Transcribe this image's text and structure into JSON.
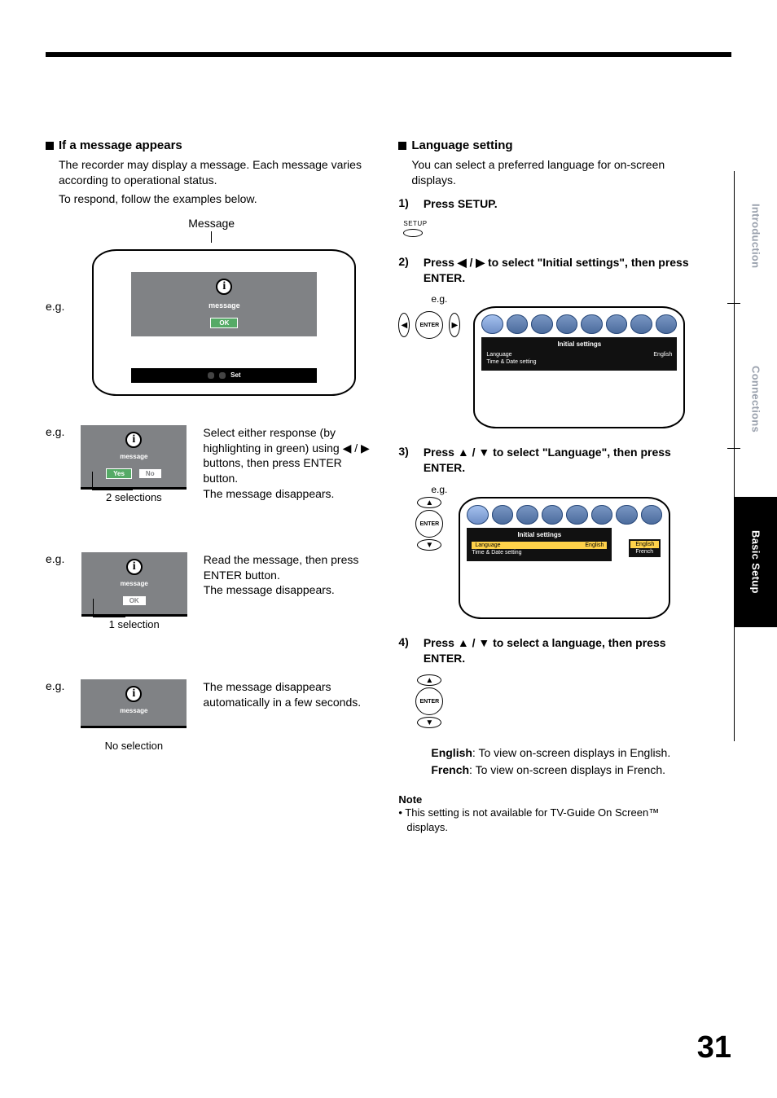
{
  "page_number": "31",
  "side_tabs": {
    "intro": "Introduction",
    "conn": "Connections",
    "basic": "Basic Setup"
  },
  "left": {
    "heading": "If a message appears",
    "intro_line1": "The recorder may display a message. Each message varies according to operational status.",
    "intro_line2": "To respond, follow the examples below.",
    "message_label": "Message",
    "eg": "e.g.",
    "tv_msg": "message",
    "ok": "OK",
    "set": "Set",
    "yes": "Yes",
    "no": "No",
    "cap2": "2 selections",
    "desc2_a": "Select either response (by highlighting in green) using",
    "desc2_b": "buttons, then press ENTER button.",
    "desc2_c": "The message disappears.",
    "cap1": "1 selection",
    "desc1_a": "Read the message, then press ENTER button.",
    "desc1_b": "The message disappears.",
    "cap0": "No selection",
    "desc0": "The message disappears automatically in a few seconds."
  },
  "right": {
    "heading": "Language setting",
    "intro": "You can select a preferred language for on-screen displays.",
    "setup_label": "SETUP",
    "enter_label": "ENTER",
    "eg": "e.g.",
    "step1": {
      "num": "1)",
      "text": "Press SETUP."
    },
    "step2": {
      "num": "2)",
      "pre": "Press ",
      "arrows": "◀ / ▶",
      "post": " to select \"Initial settings\", then press ENTER."
    },
    "step3": {
      "num": "3)",
      "pre": "Press ",
      "arrows": "▲ / ▼",
      "post": " to select \"Language\", then press ENTER."
    },
    "step4": {
      "num": "4)",
      "pre": "Press ",
      "arrows": "▲ / ▼",
      "post": " to select a language, then press ENTER."
    },
    "osd": {
      "title": "Initial settings",
      "row1_l": "Language",
      "row1_r": "English",
      "row2_l": "Time & Date setting",
      "opt_en": "English",
      "opt_fr": "French"
    },
    "lang_en_label": "English",
    "lang_en_desc": ": To view on-screen displays in English.",
    "lang_fr_label": "French",
    "lang_fr_desc": ": To view on-screen displays in French.",
    "note_head": "Note",
    "note_bullet": "• This setting is not available for TV-Guide On Screen™",
    "note_cont": "displays."
  },
  "arrows": {
    "lr": "◀ / ▶",
    "l": "◀",
    "r": "▶",
    "u": "▲",
    "d": "▼"
  }
}
